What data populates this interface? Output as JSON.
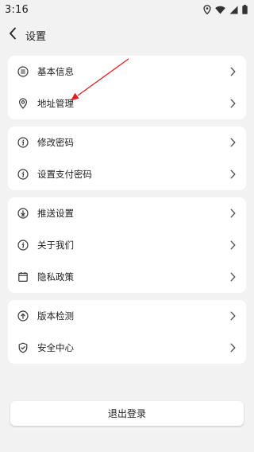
{
  "status_bar": {
    "time": "3:16",
    "icons": [
      "location-icon",
      "wifi-icon",
      "signal-icon",
      "battery-icon"
    ]
  },
  "header": {
    "title": "设置",
    "back_icon": "chevron-left-icon"
  },
  "groups": [
    {
      "items": [
        {
          "label": "基本信息",
          "icon": "list-circle-icon"
        },
        {
          "label": "地址管理",
          "icon": "location-pin-icon"
        }
      ]
    },
    {
      "items": [
        {
          "label": "修改密码",
          "icon": "info-circle-icon"
        },
        {
          "label": "设置支付密码",
          "icon": "info-circle-icon"
        }
      ]
    },
    {
      "items": [
        {
          "label": "推送设置",
          "icon": "download-circle-icon"
        },
        {
          "label": "关于我们",
          "icon": "info-circle-icon"
        },
        {
          "label": "隐私政策",
          "icon": "calendar-icon"
        }
      ]
    },
    {
      "items": [
        {
          "label": "版本检测",
          "icon": "upload-circle-icon"
        },
        {
          "label": "安全中心",
          "icon": "shield-check-icon"
        }
      ]
    }
  ],
  "logout": {
    "label": "退出登录"
  },
  "annotation": {
    "color": "#e02020",
    "icon": "red-arrow-annotation"
  },
  "colors": {
    "background": "#f2f2f2",
    "card": "#ffffff",
    "text": "#222222",
    "chevron": "#555555"
  }
}
